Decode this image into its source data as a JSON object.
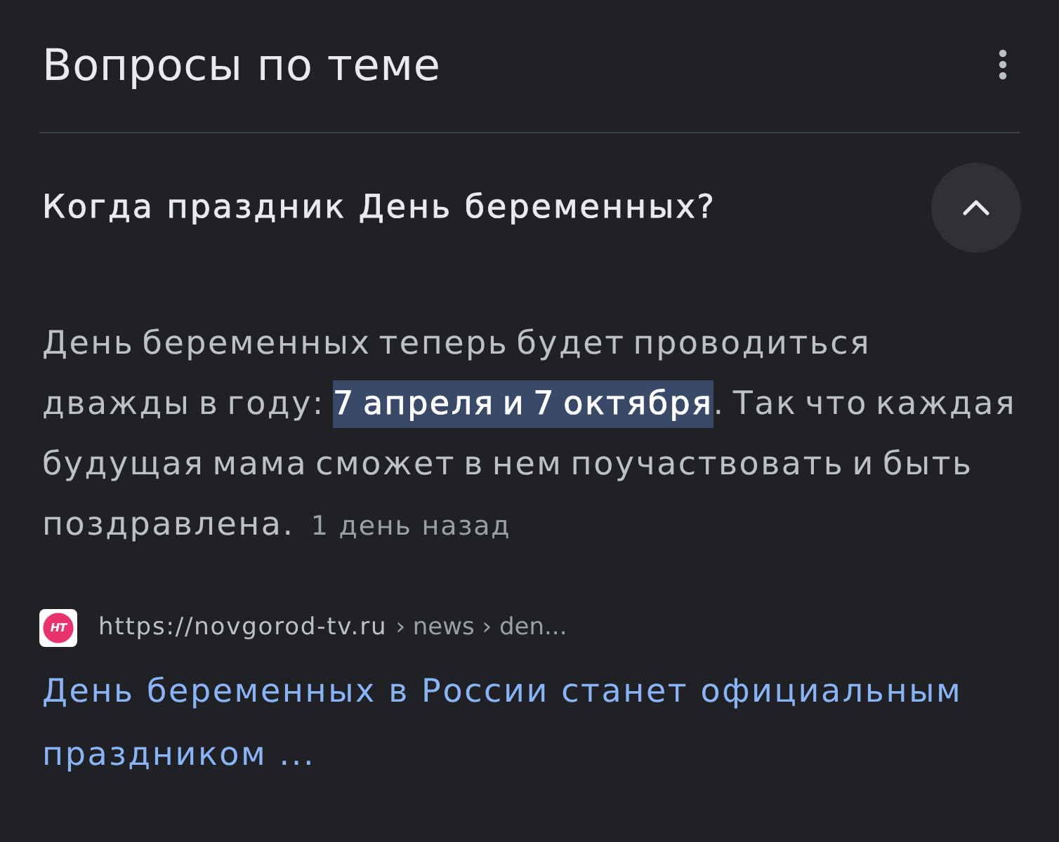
{
  "section": {
    "title": "Вопросы по теме"
  },
  "question": {
    "text": "Когда праздник День беременных?",
    "expanded": true
  },
  "answer": {
    "text": "День беременных теперь будет проводиться дважды в году: **7 апреля и 7 октября**. Так что каждая будущая мама сможет в нем поучаствовать и быть поздравлена.",
    "age": "1 день назад"
  },
  "source": {
    "favicon_text": "НТ",
    "url": "https://novgorod-tv.ru",
    "path": "› news › den...",
    "title": "День беременных в России станет официальным праздником ..."
  }
}
